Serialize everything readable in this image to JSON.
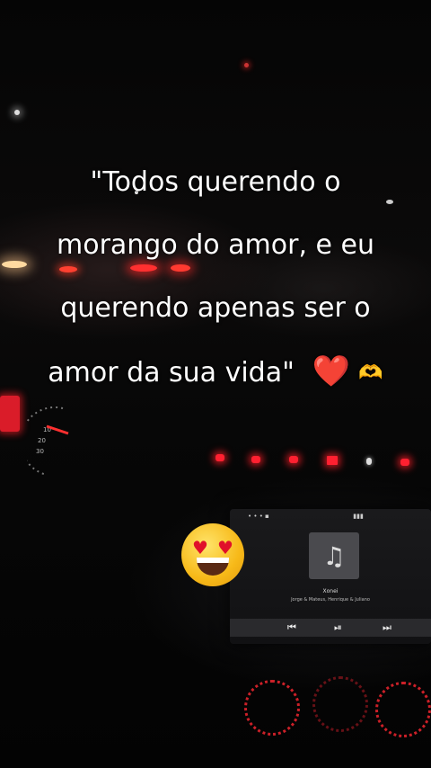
{
  "caption": {
    "lines": [
      "\"Todos querendo o",
      "morango do amor, e eu",
      "querendo apenas ser o",
      "amor da sua vida\""
    ],
    "emoji_heart": "❤️",
    "emoji_hands": "🫶"
  },
  "sticker": {
    "icon": "heart-eyes-emoji-icon"
  },
  "media_screen": {
    "song_title": "Xonei",
    "artist": "Jorge & Mateus, Henrique & Juliano",
    "album_icon": "music-note-icon",
    "controls": [
      "previous-icon",
      "play-pause-icon",
      "next-icon"
    ]
  },
  "gauge": {
    "tick_labels": [
      "10",
      "20",
      "30"
    ]
  },
  "colors": {
    "dash_red": "#ff2030",
    "text": "#ffffff"
  }
}
